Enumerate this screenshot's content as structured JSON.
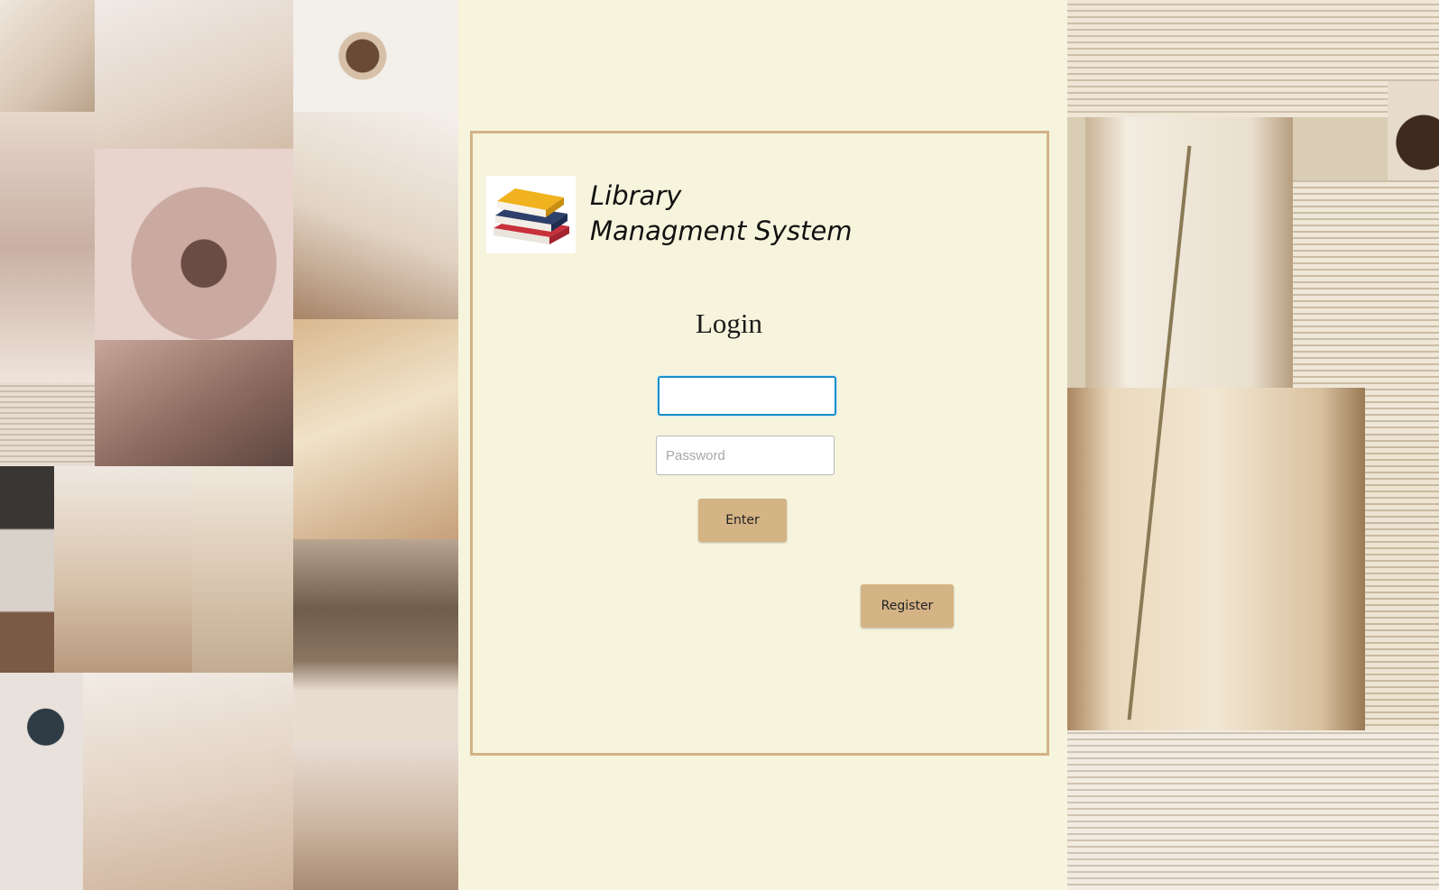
{
  "app": {
    "title_line1": "Library",
    "title_line2": "Managment System"
  },
  "login": {
    "heading": "Login",
    "username_value": "",
    "username_placeholder": "",
    "password_value": "",
    "password_placeholder": "Password",
    "enter_label": "Enter",
    "register_label": "Register"
  },
  "colors": {
    "background": "#f6f4dc",
    "panel_border": "#d3b287",
    "button": "#d4b384",
    "focus_border": "#1a8fc9"
  }
}
